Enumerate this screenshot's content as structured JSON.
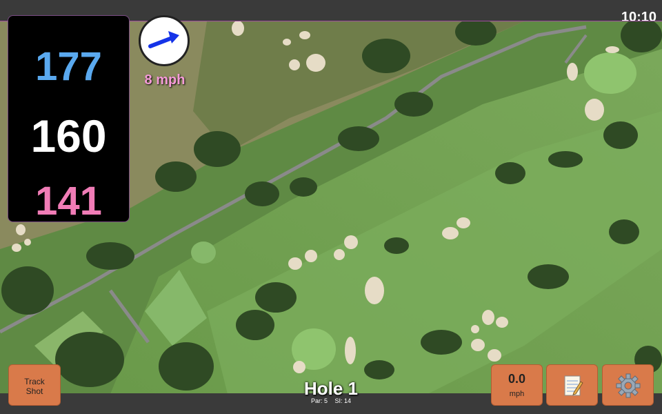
{
  "status": {
    "time": "10:10"
  },
  "distances": {
    "back": "177",
    "middle": "160",
    "front": "141"
  },
  "wind": {
    "speed": "8 mph",
    "direction_icon": "wind-arrow-icon"
  },
  "buttons": {
    "track_shot_line1": "Track",
    "track_shot_line2": "Shot",
    "speed_value": "0.0",
    "speed_unit": "mph",
    "notes_icon": "notepad-icon",
    "settings_icon": "gear-icon"
  },
  "hole": {
    "title": "Hole 1",
    "par": "Par: 5",
    "si": "SI: 14"
  },
  "colors": {
    "back": "#5aa9ef",
    "middle": "#ffffff",
    "front": "#f07cb6",
    "button": "#d97a4a",
    "wind_label": "#f59bd8"
  }
}
